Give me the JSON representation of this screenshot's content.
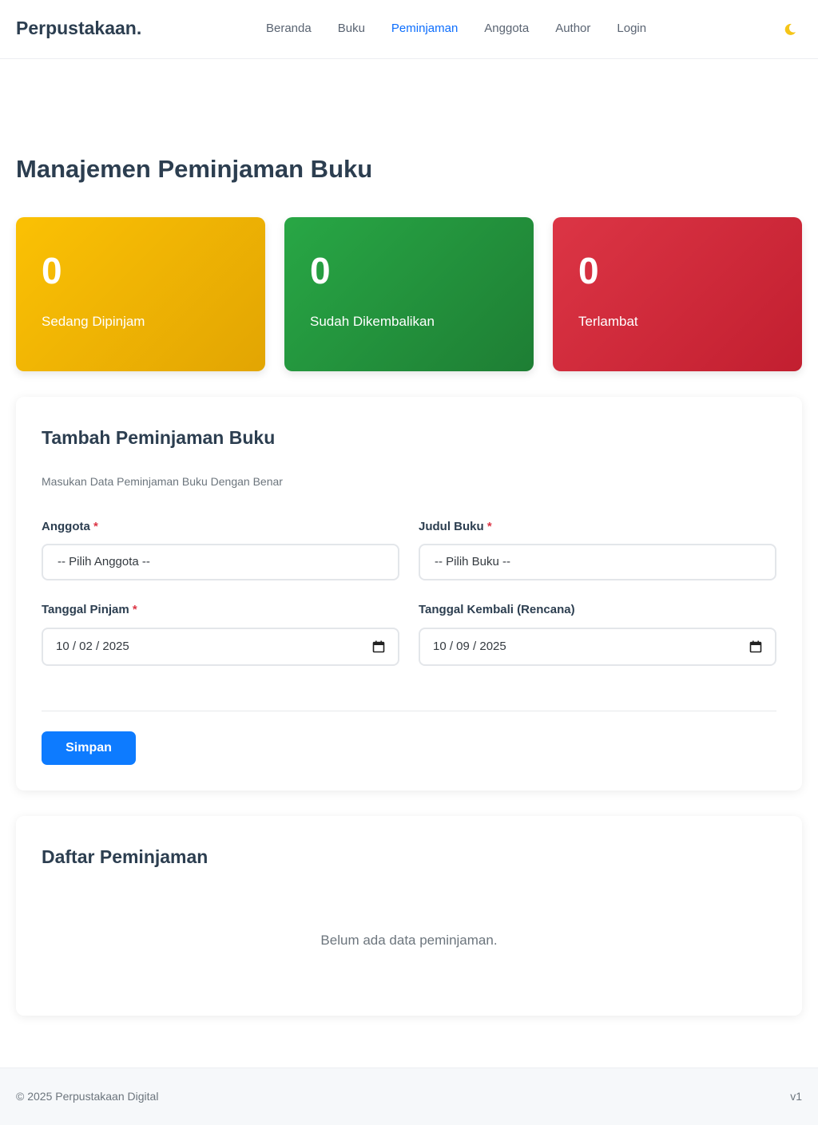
{
  "nav": {
    "brand": "Perpustakaan.",
    "links": [
      "Beranda",
      "Buku",
      "Peminjaman",
      "Anggota",
      "Author",
      "Login"
    ],
    "active_index": 2,
    "theme_icon": "moon-icon"
  },
  "page": {
    "title": "Manajemen Peminjaman Buku"
  },
  "stats": [
    {
      "value": "0",
      "label": "Sedang Dipinjam",
      "color": "#fbc104"
    },
    {
      "value": "0",
      "label": "Sudah Dikembalikan",
      "color": "#28a745"
    },
    {
      "value": "0",
      "label": "Terlambat",
      "color": "#dc3545"
    }
  ],
  "form": {
    "title": "Tambah Peminjaman Buku",
    "subtitle": "Masukan Data Peminjaman Buku Dengan Benar",
    "anggota_label": "Anggota",
    "anggota_value": "-- Pilih Anggota --",
    "judul_label": "Judul Buku",
    "judul_value": "-- Pilih Buku --",
    "tgl_pinjam_label": "Tanggal Pinjam",
    "tgl_pinjam_value": "10 / 02 / 2025",
    "tgl_kembali_label": "Tanggal Kembali (Rencana)",
    "tgl_kembali_value": "10 / 09 / 2025",
    "required_mark": "*",
    "save_label": "Simpan",
    "accent": "#0d7bff"
  },
  "list": {
    "title": "Daftar Peminjaman",
    "empty_text": "Belum ada data peminjaman."
  },
  "footer": {
    "copyright": "© 2025 Perpustakaan Digital",
    "version": "v1"
  }
}
